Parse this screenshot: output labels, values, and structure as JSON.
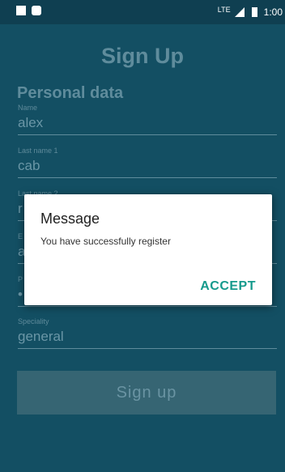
{
  "statusbar": {
    "time": "1:00",
    "network": "LTE",
    "left_icons": [
      "sd-card-icon",
      "android-icon"
    ]
  },
  "app": {
    "title": "Sign Up",
    "section_title": "Personal data",
    "fields": [
      {
        "label": "Name",
        "value": "alex"
      },
      {
        "label": "Last name 1",
        "value": "cab"
      },
      {
        "label": "Last name 2",
        "value": "r"
      },
      {
        "label": "E",
        "value": "a"
      },
      {
        "label": "P",
        "value": "•"
      },
      {
        "label": "Speciality",
        "value": "general"
      }
    ],
    "signup_label": "Sign up"
  },
  "dialog": {
    "title": "Message",
    "message": "You have successfully register",
    "accept_label": "ACCEPT"
  },
  "colors": {
    "background": "#134f63",
    "statusbar": "#0f3f51",
    "accent": "#159a8c"
  }
}
